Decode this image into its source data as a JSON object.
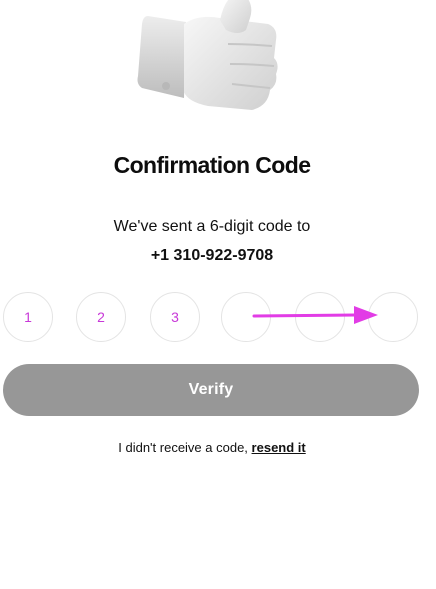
{
  "hero": {
    "icon": "thumbs-up-icon"
  },
  "header": {
    "title": "Confirmation Code"
  },
  "message": {
    "text": "We've sent a 6-digit code to",
    "phone": "+1 310-922-9708"
  },
  "code": {
    "digits": [
      "1",
      "2",
      "3",
      "",
      "",
      ""
    ]
  },
  "annotation": {
    "icon": "arrow-right-icon",
    "color": "#e23ce6"
  },
  "actions": {
    "verify_label": "Verify",
    "verify_color": "#979797"
  },
  "resend": {
    "prefix": "I didn't receive a code,",
    "link": "resend it"
  }
}
